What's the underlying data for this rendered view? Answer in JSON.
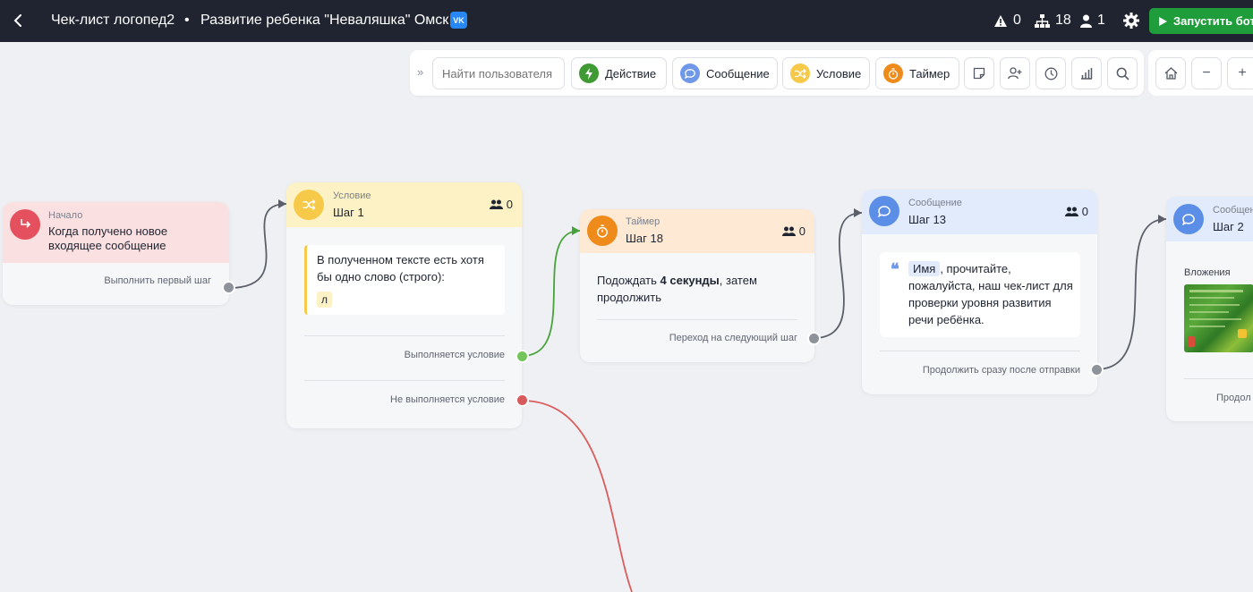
{
  "header": {
    "title": "Чек-лист логопед2",
    "separator": "•",
    "subtitle": "Развитие ребенка \"Неваляшка\" Омск",
    "network_badge": "VK",
    "warnings_count": "0",
    "steps_count": "18",
    "users_count": "1",
    "launch_label": "Запустить бота"
  },
  "toolbar": {
    "search_placeholder": "Найти пользователя",
    "action_label": "Действие",
    "message_label": "Сообщение",
    "condition_label": "Условие",
    "timer_label": "Таймер",
    "zoom_out": "−",
    "zoom_in": "+"
  },
  "colors": {
    "topbar": "#1f2430",
    "launch": "#1f9d3a",
    "start": "#e5505f",
    "condition": "#f7c948",
    "timer": "#ef8b1a",
    "message": "#5b8ee6",
    "action": "#3f9a33",
    "wire_default": "#5a5f69",
    "wire_true": "#46a33a",
    "wire_false": "#db5c5c"
  },
  "nodes": {
    "start": {
      "kind": "Начало",
      "text": "Когда получено новое входящее сообщение",
      "output": "Выполнить первый шаг"
    },
    "step1": {
      "kind": "Условие",
      "name": "Шаг 1",
      "users": "0",
      "condition_text": "В полученном тексте есть хотя бы одно слово (строго):",
      "keyword": "л",
      "output_true": "Выполняется условие",
      "output_false": "Не выполняется условие"
    },
    "step18": {
      "kind": "Таймер",
      "name": "Шаг 18",
      "users": "0",
      "text_before": "Подождать ",
      "text_bold": "4 секунды",
      "text_after": ", затем продолжить",
      "output": "Переход на следующий шаг"
    },
    "step13": {
      "kind": "Сообщение",
      "name": "Шаг 13",
      "users": "0",
      "variable": "Имя",
      "message": ", прочитайте, пожалуйста, наш чек-лист для проверки уровня развития речи ребёнка.",
      "output": "Продолжить сразу после отправки"
    },
    "step2": {
      "kind": "Сообщение",
      "name": "Шаг 2",
      "attachments_label": "Вложения",
      "output": "Продол"
    }
  }
}
